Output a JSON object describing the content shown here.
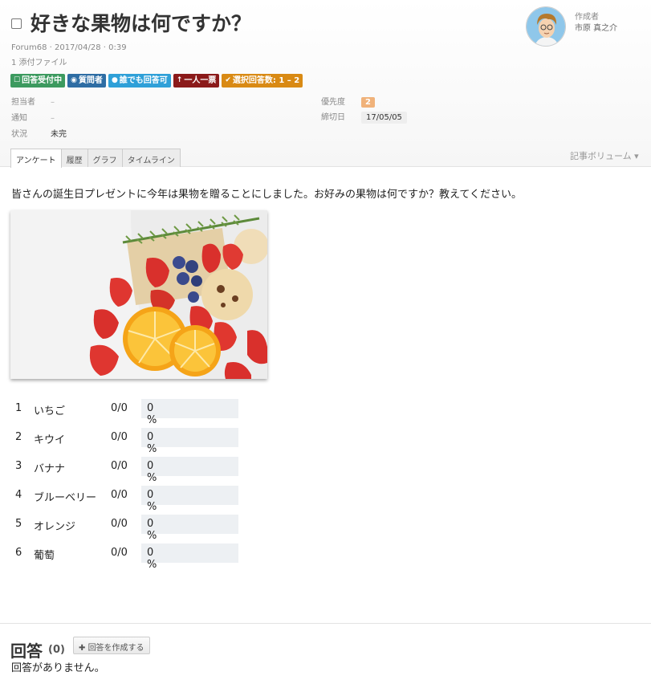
{
  "title": "好きな果物は何ですか？",
  "meta": {
    "forum_date": "Forum68 · 2017/04/28 · 0:39",
    "attachments": "1 添付ファイル"
  },
  "badges": [
    {
      "label": "回答受付中",
      "icon": "☐",
      "color": "#3c9a5f"
    },
    {
      "label": "質問者",
      "icon": "👁",
      "color": "#2e6da4"
    },
    {
      "label": "誰でも回答可",
      "icon": "💬",
      "color": "#2fa0d8"
    },
    {
      "label": "一人一票",
      "icon": "🡅",
      "color": "#8b1a1a"
    },
    {
      "label": "選択回答数: 1 – 2",
      "icon": "✔",
      "color": "#d98a14"
    }
  ],
  "fields": {
    "assignee": {
      "label": "担当者",
      "value": "–"
    },
    "notify": {
      "label": "通知",
      "value": "–"
    },
    "status": {
      "label": "状況",
      "value": "未完"
    },
    "priority": {
      "label": "優先度",
      "value": "2"
    },
    "deadline": {
      "label": "締切日",
      "value": "17/05/05"
    }
  },
  "author": {
    "label": "作成者",
    "name": "市原 真之介"
  },
  "tabs": [
    "アンケート",
    "履歴",
    "グラフ",
    "タイムライン"
  ],
  "volume": "記事ボリューム ▾",
  "description": "皆さんの誕生日プレゼントに今年は果物を贈ることにしました。お好みの果物は何ですか？教えてください。",
  "options": [
    {
      "num": "1",
      "name": "いちご",
      "count": "0/0",
      "pct": "0 %"
    },
    {
      "num": "2",
      "name": "キウイ",
      "count": "0/0",
      "pct": "0 %"
    },
    {
      "num": "3",
      "name": "バナナ",
      "count": "0/0",
      "pct": "0 %"
    },
    {
      "num": "4",
      "name": "ブルーベリー",
      "count": "0/0",
      "pct": "0 %"
    },
    {
      "num": "5",
      "name": "オレンジ",
      "count": "0/0",
      "pct": "0 %"
    },
    {
      "num": "6",
      "name": "葡萄",
      "count": "0/0",
      "pct": "0 %"
    }
  ],
  "answers": {
    "title": "回答",
    "count": "(0)",
    "create_button": "回答を作成する",
    "empty": "回答がありません。"
  }
}
